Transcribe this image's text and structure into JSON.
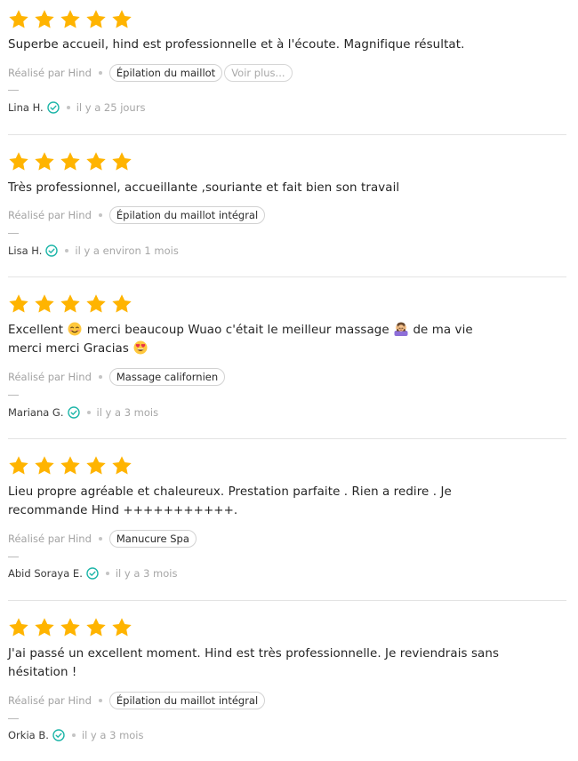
{
  "colors": {
    "star": "#FFB400",
    "verified": "#1CB5A8",
    "separator": "#E3E3E3",
    "muted_text": "#A3A3A3"
  },
  "icons": {
    "star": "star-icon",
    "verified": "verified-check-icon",
    "emoji_smile": "smiling-face-with-smiling-eyes-emoji",
    "emoji_massage": "person-getting-massage-emoji",
    "emoji_heart_eyes": "heart-eyes-emoji"
  },
  "reviews": [
    {
      "rating": 5,
      "text_lines": [
        "Superbe accueil, hind est professionnelle et à l'écoute. Magnifique résultat."
      ],
      "performed_by": "Réalisé par Hind",
      "service": "Épilation du maillot",
      "more_label": "Voir plus...",
      "author": "Lina H.",
      "date": "il y a 25 jours"
    },
    {
      "rating": 5,
      "text_lines": [
        "Très professionnel, accueillante ,souriante et fait bien son travail"
      ],
      "performed_by": "Réalisé par Hind",
      "service": "Épilation du maillot intégral",
      "author": "Lisa H.",
      "date": "il y a environ 1 mois"
    },
    {
      "rating": 5,
      "text_parts": {
        "a": "Excellent",
        "b": "merci beaucoup Wuao c'était le meilleur massage",
        "c": "de ma vie",
        "d": "merci merci Gracias"
      },
      "performed_by": "Réalisé par Hind",
      "service": "Massage californien",
      "author": "Mariana G.",
      "date": "il y a 3 mois"
    },
    {
      "rating": 5,
      "text_lines": [
        "Lieu propre agréable et chaleureux. Prestation parfaite . Rien a redire . Je",
        "recommande Hind +++++++++++."
      ],
      "performed_by": "Réalisé par Hind",
      "service": "Manucure Spa",
      "author": "Abid Soraya E.",
      "date": "il y a 3 mois"
    },
    {
      "rating": 5,
      "text_lines": [
        "J'ai passé un excellent moment. Hind est très professionnelle. Je reviendrais sans",
        "hésitation !"
      ],
      "performed_by": "Réalisé par Hind",
      "service": "Épilation du maillot intégral",
      "author": "Orkia B.",
      "date": "il y a 3 mois"
    }
  ]
}
